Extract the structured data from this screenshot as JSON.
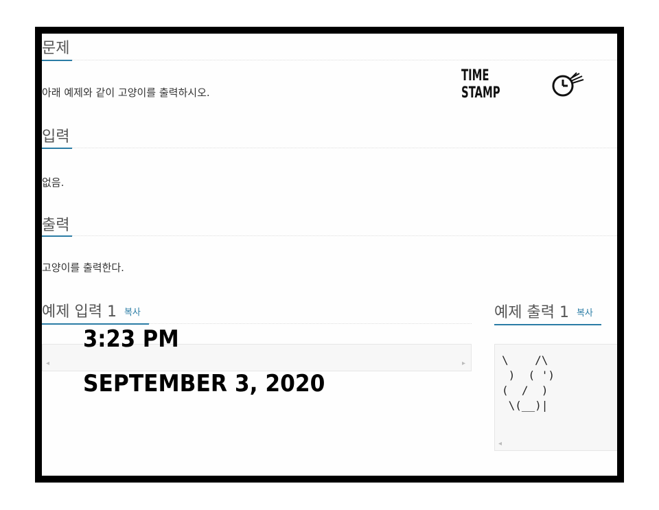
{
  "problem": {
    "heading": "문제",
    "text": "아래 예제와 같이 고양이를 출력하시오."
  },
  "input": {
    "heading": "입력",
    "text": "없음."
  },
  "output": {
    "heading": "출력",
    "text": "고양이를 출력한다."
  },
  "sample_input": {
    "heading": "예제 입력 1",
    "copy_label": "복사"
  },
  "sample_output": {
    "heading": "예제 출력 1",
    "copy_label": "복사",
    "content": "\\    /\\\n )  ( ')\n(  /  )\n \\(__)|"
  },
  "timestamp_logo": {
    "text": "TIME STAMP",
    "icon": "clock-stamp-icon"
  },
  "overlay": {
    "time": "3:23 PM",
    "date": "SEPTEMBER 3, 2020"
  },
  "colors": {
    "accent": "#2a7ca5",
    "frame": "#000000"
  }
}
